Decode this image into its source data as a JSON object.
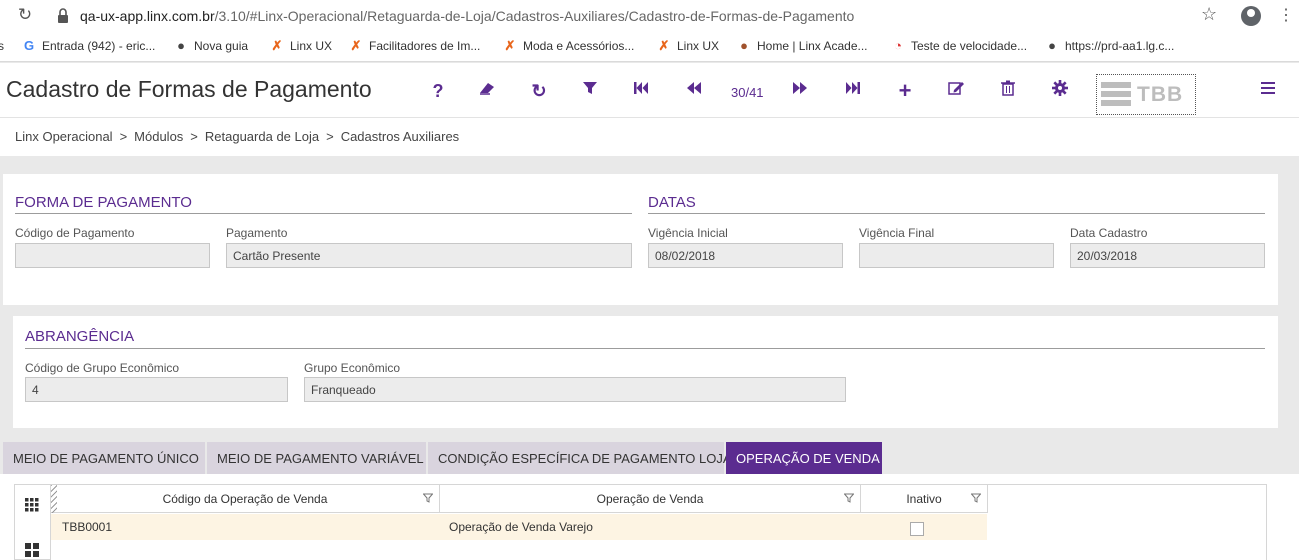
{
  "browser": {
    "url_host": "qa-ux-app.linx.com.br",
    "url_path": "/3.10/#Linx-Operacional/Retaguarda-de-Loja/Cadastros-Auxiliares/Cadastro-de-Formas-de-Pagamento",
    "bookmarks": [
      {
        "label": "Entrada (942) - eric...",
        "icon": "gmail-icon"
      },
      {
        "label": "Nova guia",
        "icon": "globe-icon"
      },
      {
        "label": "Linx UX",
        "icon": "linx-icon"
      },
      {
        "label": "Facilitadores de Im...",
        "icon": "linx-icon"
      },
      {
        "label": "Moda e Acessórios...",
        "icon": "linx-icon"
      },
      {
        "label": "Linx UX",
        "icon": "linx-icon"
      },
      {
        "label": "Home | Linx Acade...",
        "icon": "academy-icon"
      },
      {
        "label": "Teste de velocidade...",
        "icon": "speedometer-icon"
      },
      {
        "label": "https://prd-aa1.lg.c...",
        "icon": "globe-icon"
      }
    ]
  },
  "header": {
    "title": "Cadastro de Formas de Pagamento",
    "pager": "30/41",
    "logo_text": "TBB",
    "accent": "#5b2c90"
  },
  "breadcrumb": [
    "Linx Operacional",
    "Módulos",
    "Retaguarda de Loja",
    "Cadastros Auxiliares"
  ],
  "forma": {
    "title": "FORMA DE PAGAMENTO",
    "codigo_label": "Código de Pagamento",
    "codigo_value": "",
    "pagamento_label": "Pagamento",
    "pagamento_value": "Cartão Presente"
  },
  "datas": {
    "title": "DATAS",
    "inicial_label": "Vigência Inicial",
    "inicial_value": "08/02/2018",
    "final_label": "Vigência Final",
    "final_value": "",
    "cadastro_label": "Data Cadastro",
    "cadastro_value": "20/03/2018"
  },
  "abrangencia": {
    "title": "ABRANGÊNCIA",
    "codigo_label": "Código de Grupo Econômico",
    "codigo_value": "4",
    "grupo_label": "Grupo Econômico",
    "grupo_value": "Franqueado"
  },
  "tabs": [
    {
      "label": "MEIO DE PAGAMENTO ÚNICO",
      "active": false
    },
    {
      "label": "MEIO DE PAGAMENTO VARIÁVEL",
      "active": false
    },
    {
      "label": "CONDIÇÃO ESPECÍFICA DE PAGAMENTO LOJA",
      "active": false
    },
    {
      "label": "OPERAÇÃO DE VENDA",
      "active": true
    }
  ],
  "grid": {
    "columns": [
      "Código da Operação de Venda",
      "Operação de Venda",
      "Inativo"
    ],
    "rows": [
      {
        "codigo": "TBB0001",
        "operacao": "Operação de Venda Varejo",
        "inativo": false
      }
    ]
  }
}
